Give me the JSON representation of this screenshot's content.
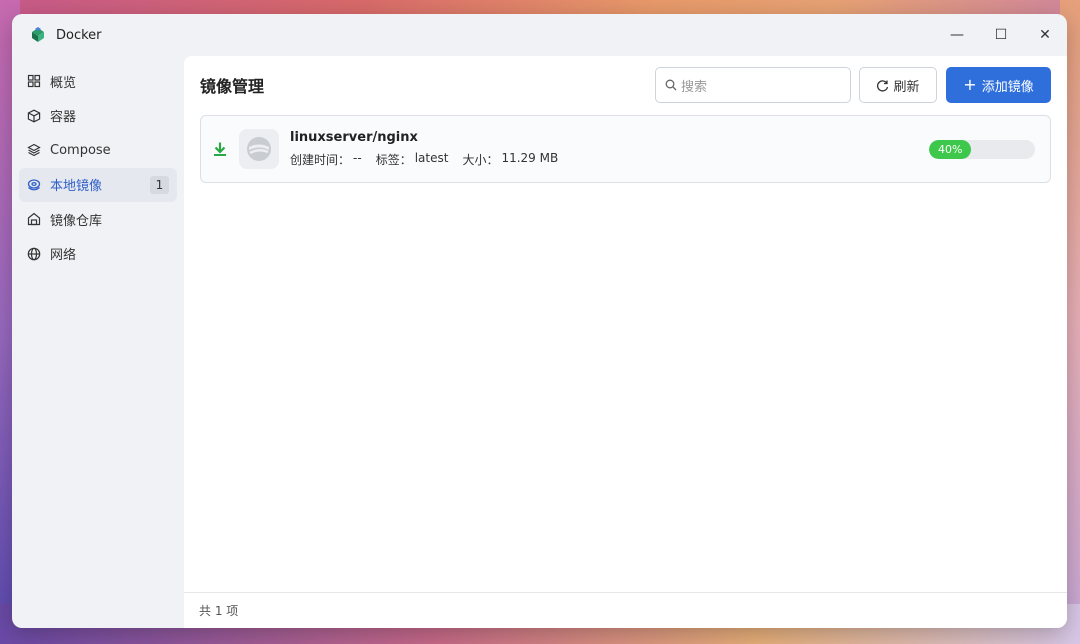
{
  "window": {
    "title": "Docker"
  },
  "window_controls": {
    "minimize": "—",
    "maximize": "☐",
    "close": "✕"
  },
  "sidebar": {
    "items": [
      {
        "label": "概览",
        "icon": "grid-icon"
      },
      {
        "label": "容器",
        "icon": "cube-icon"
      },
      {
        "label": "Compose",
        "icon": "layers-icon"
      },
      {
        "label": "本地镜像",
        "icon": "disk-icon",
        "active": true,
        "badge": "1"
      },
      {
        "label": "镜像仓库",
        "icon": "warehouse-icon"
      },
      {
        "label": "网络",
        "icon": "globe-icon"
      }
    ]
  },
  "main": {
    "title": "镜像管理",
    "search_placeholder": "搜索",
    "refresh_label": "刷新",
    "add_label": "添加镜像",
    "images": [
      {
        "name": "linuxserver/nginx",
        "created_label": "创建时间：",
        "created_value": "--",
        "tag_label": "标签：",
        "tag_value": "latest",
        "size_label": "大小：",
        "size_value": "11.29 MB",
        "progress": 40,
        "progress_text": "40%"
      }
    ],
    "footer": "共 1 项"
  },
  "colors": {
    "accent": "#2f6fdc",
    "active_nav": "#2f5fc8",
    "progress": "#3ec84b",
    "download": "#2aa846"
  }
}
